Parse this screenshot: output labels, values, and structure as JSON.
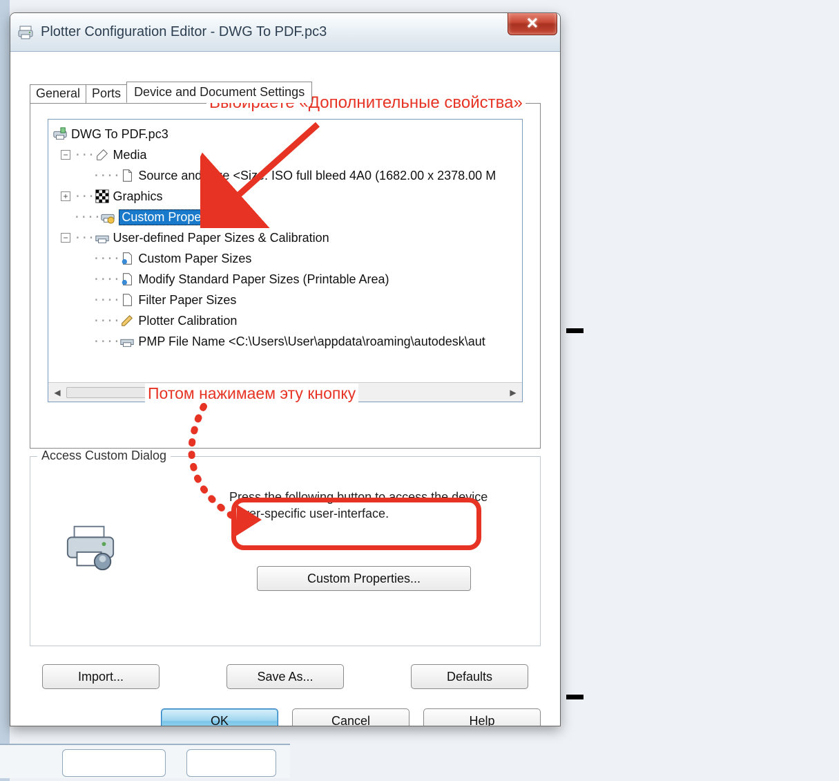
{
  "window": {
    "title": "Plotter Configuration Editor - DWG To PDF.pc3"
  },
  "tabs": {
    "general": "General",
    "ports": "Ports",
    "device": "Device and Document Settings"
  },
  "tree": {
    "root": "DWG To PDF.pc3",
    "media": "Media",
    "media_source": "Source and Size <Size: ISO full bleed 4A0 (1682.00 x 2378.00 M",
    "graphics": "Graphics",
    "custom_properties": "Custom Properties",
    "user_defined": "User-defined Paper Sizes & Calibration",
    "ud_custom": "Custom Paper Sizes",
    "ud_modify": "Modify Standard Paper Sizes (Printable Area)",
    "ud_filter": "Filter Paper Sizes",
    "ud_plotter_cal": "Plotter Calibration",
    "ud_pmp": "PMP File Name <C:\\Users\\User\\appdata\\roaming\\autodesk\\aut"
  },
  "fieldset": {
    "legend": "Access Custom Dialog",
    "desc": "Press the following button to access the device driver-specific user-interface.",
    "button": "Custom Properties..."
  },
  "buttons": {
    "import": "Import...",
    "save_as": "Save As...",
    "defaults": "Defaults",
    "ok": "OK",
    "cancel": "Cancel",
    "help": "Help"
  },
  "annotations": {
    "ann1": "Выбираете «Дополнительные свойства»",
    "ann2": "Потом нажимаем эту кнопку"
  }
}
